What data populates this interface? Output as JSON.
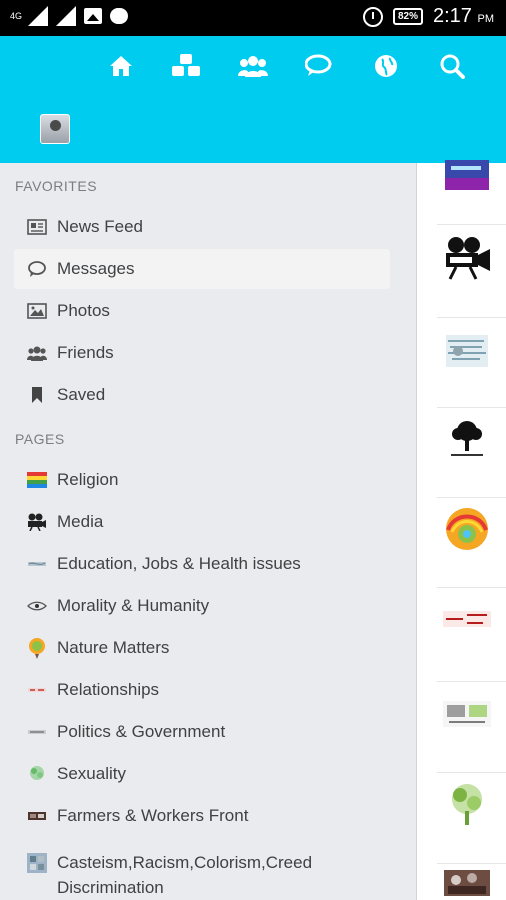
{
  "status_bar": {
    "network": "4G",
    "battery": "82%",
    "time": "2:17",
    "ampm": "PM"
  },
  "toolbar_icons": [
    "menu-icon",
    "home-icon",
    "groups-icon",
    "friends-icon",
    "messages-icon",
    "globe-icon",
    "search-icon"
  ],
  "colors": {
    "header": "#00ccf0",
    "drawer_bg": "#e9ebee",
    "text": "#3f4143",
    "section": "#7b7d80"
  },
  "favorites": {
    "title": "FAVORITES",
    "items": [
      {
        "label": "News Feed",
        "icon": "newsfeed-icon"
      },
      {
        "label": "Messages",
        "icon": "messages-icon",
        "active": true
      },
      {
        "label": "Photos",
        "icon": "photos-icon"
      },
      {
        "label": "Friends",
        "icon": "friends-icon"
      },
      {
        "label": "Saved",
        "icon": "bookmark-icon"
      }
    ]
  },
  "pages": {
    "title": "PAGES",
    "items": [
      {
        "label": "Religion",
        "icon": "religion-icon"
      },
      {
        "label": "Media",
        "icon": "media-icon"
      },
      {
        "label": "Education, Jobs & Health issues",
        "icon": "education-icon"
      },
      {
        "label": "Morality & Humanity",
        "icon": "morality-icon"
      },
      {
        "label": "Nature Matters",
        "icon": "nature-icon"
      },
      {
        "label": "Relationships",
        "icon": "relationships-icon"
      },
      {
        "label": "Politics & Government",
        "icon": "politics-icon"
      },
      {
        "label": "Sexuality",
        "icon": "sexuality-icon"
      },
      {
        "label": "Farmers & Workers Front",
        "icon": "farmers-icon"
      },
      {
        "label": "Casteism,Racism,Colorism,Creed Discrimination",
        "icon": "casteism-icon"
      }
    ]
  },
  "strip_thumbs": [
    "religion-thumb",
    "media-thumb",
    "education-thumb",
    "tree-thumb",
    "nature-thumb",
    "relationships-thumb",
    "politics-thumb",
    "sexuality-thumb",
    "farmers-thumb"
  ]
}
